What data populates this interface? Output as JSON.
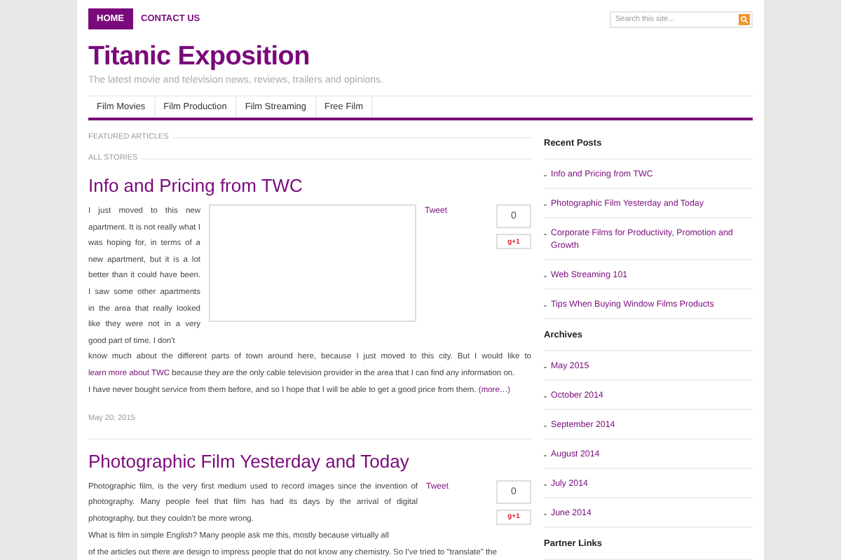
{
  "topnav": {
    "items": [
      {
        "label": "HOME",
        "selected": true
      },
      {
        "label": "CONTACT US",
        "selected": false
      }
    ],
    "search": {
      "placeholder": "Search this site..."
    }
  },
  "site": {
    "title": "Titanic Exposition",
    "tagline": "The latest movie and television news, reviews, trailers and opinions."
  },
  "menu": [
    {
      "label": "Film Movies"
    },
    {
      "label": "Film Production"
    },
    {
      "label": "Film Streaming"
    },
    {
      "label": "Free Film"
    }
  ],
  "sections": [
    "FEATURED ARTICLES",
    "ALL STORIES"
  ],
  "posts": [
    {
      "title": "Info and Pricing from TWC",
      "embed": true,
      "tweet": "Tweet",
      "count": "0",
      "plus": "g+1",
      "side_text": [
        "I just moved to this new apartment. It is not really what I was hoping for, in terms of a new apartment, but it is a lot better than it could have been. I saw some other apartments in the area that really looked like they were not in a very good part of time. I don't"
      ],
      "paragraphs": [
        {
          "parts": [
            {
              "text": "know much about the different parts of town around here, because I just moved to this city. But I would like to "
            },
            {
              "text": "learn more about TWC",
              "link": true
            },
            {
              "text": " because they are the only cable television provider in the area that I can find any information on."
            }
          ]
        },
        {
          "parts": [
            {
              "text": "I have never bought service from them before, and so I hope that I will be able to get a good price from them. "
            },
            {
              "text": "(more…)",
              "link": true
            }
          ]
        }
      ],
      "date": "May 20, 2015"
    },
    {
      "title": "Photographic Film Yesterday and Today",
      "embed": false,
      "tweet": "Tweet",
      "count": "0",
      "plus": "g+1",
      "side_text": [
        "Photographic film, is the very first medium used to record images since the invention of photography. Many people feel that film has had its days by the arrival of digital photography, but they couldn't be more wrong.",
        "What is film in simple English? Many people ask me this, mostly because virtually all"
      ],
      "paragraphs": [
        {
          "parts": [
            {
              "text": "of the articles out there are design to impress people that do not know any chemistry. So I've tried to \"translate\" the"
            }
          ]
        }
      ]
    }
  ],
  "sidebar": [
    {
      "heading": "Recent Posts",
      "items": [
        "Info and Pricing from TWC",
        "Photographic Film Yesterday and Today",
        "Corporate Films for Productivity, Promotion and Growth",
        "Web Streaming 101",
        "Tips When Buying Window Films Products"
      ]
    },
    {
      "heading": "Archives",
      "items": [
        "May 2015",
        "October 2014",
        "September 2014",
        "August 2014",
        "July 2014",
        "June 2014"
      ]
    },
    {
      "heading": "Partner Links"
    }
  ]
}
